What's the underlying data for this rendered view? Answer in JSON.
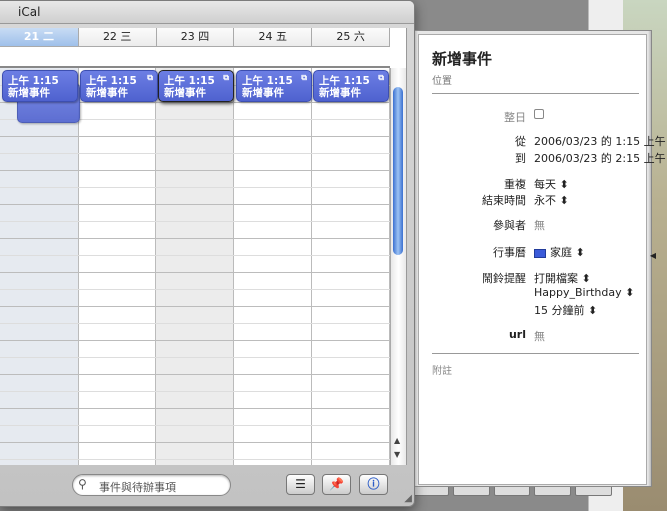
{
  "app": {
    "title": "iCal"
  },
  "days": [
    "21 二",
    "22 三",
    "23 四",
    "24 五",
    "25 六"
  ],
  "events": [
    {
      "time": "上午 1:15",
      "name": "新增事件"
    },
    {
      "time": "上午 1:15",
      "name": "新增事件"
    },
    {
      "time": "上午 1:15",
      "name": "新增事件"
    },
    {
      "time": "上午 1:15",
      "name": "新增事件"
    },
    {
      "time": "上午 1:15",
      "name": "新增事件"
    }
  ],
  "toolbar": {
    "search_placeholder": "事件與待辦事項"
  },
  "info": {
    "title": "新增事件",
    "location_placeholder": "位置",
    "allday_label": "整日",
    "from_label": "從",
    "from_value": "2006/03/23  的   1:15 上午",
    "to_label": "到",
    "to_value": "2006/03/23  的   2:15 上午",
    "repeat_label": "重複",
    "repeat_value": "每天 ⬍",
    "end_label": "結束時間",
    "end_value": "永不 ⬍",
    "attendees_label": "參與者",
    "attendees_value": "無",
    "calendar_label": "行事曆",
    "calendar_value": "家庭 ⬍",
    "calendar_color": "#3b5bd9",
    "alarm_label": "鬧鈴提醒",
    "alarm_action": "打開檔案 ⬍",
    "alarm_file": "Happy_Birthday ⬍",
    "alarm_time": "15  分鐘前 ⬍",
    "url_label": "url",
    "url_value": "無",
    "notes_placeholder": "附註"
  }
}
